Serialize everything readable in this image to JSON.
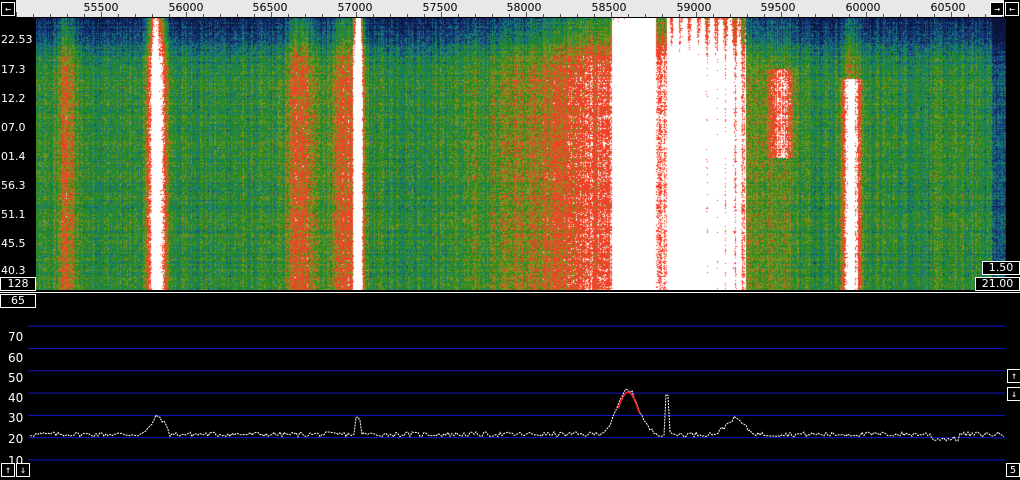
{
  "freq_axis": {
    "labels": [
      "55500",
      "56000",
      "56500",
      "57000",
      "57500",
      "58000",
      "58500",
      "59000",
      "59500",
      "60000",
      "60500"
    ],
    "left_button": "←",
    "right_buttons": [
      "→",
      "←"
    ]
  },
  "waterfall": {
    "time_labels": [
      "22.53",
      "17.3",
      "12.2",
      "07.0",
      "01.4",
      "56.3",
      "51.1",
      "45.5",
      "40.3"
    ],
    "avg_value": "128",
    "scale_top": "1.50",
    "scale_bottom": "21.00"
  },
  "spectrum": {
    "top_value": "65",
    "db_labels": [
      "70",
      "60",
      "50",
      "40",
      "30",
      "20",
      "10"
    ],
    "up_button": "↑",
    "down_button": "↓",
    "corner_value": "5"
  },
  "colors": {
    "background": "#000000",
    "grid": "#1414c8",
    "trace": "#ffffff",
    "peak": "#ff2020"
  }
}
